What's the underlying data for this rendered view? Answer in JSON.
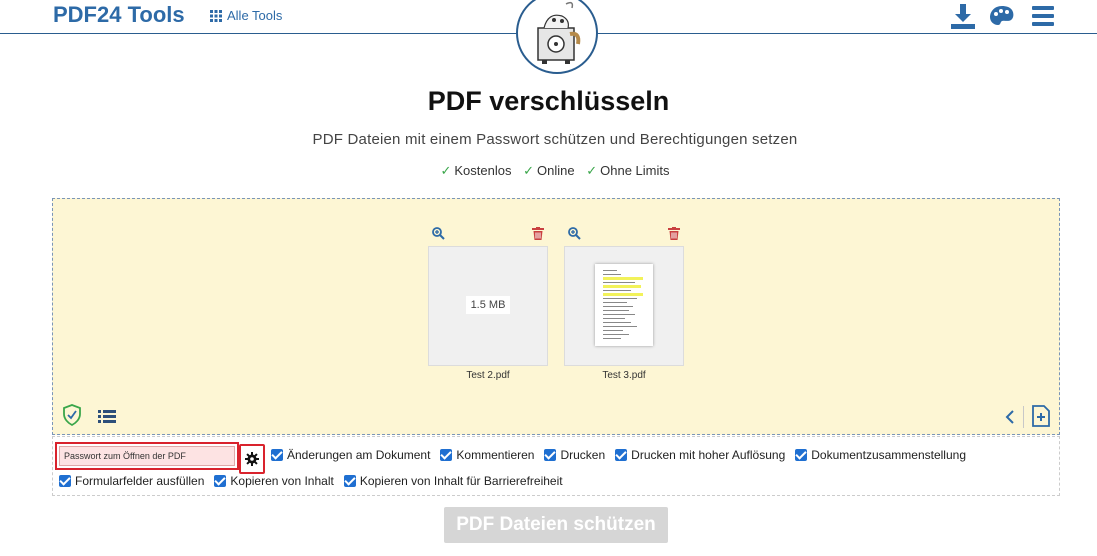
{
  "header": {
    "brand": "PDF24 Tools",
    "all_tools": "Alle Tools"
  },
  "page": {
    "title": "PDF verschlüsseln",
    "subtitle": "PDF Dateien mit einem Passwort schützen und Berechtigungen setzen",
    "features": [
      "Kostenlos",
      "Online",
      "Ohne Limits"
    ]
  },
  "files": [
    {
      "name": "Test 2.pdf",
      "size": "1.5 MB"
    },
    {
      "name": "Test 3.pdf"
    }
  ],
  "options": {
    "password_placeholder": "Passwort zum Öffnen der PDF",
    "checkboxes": [
      {
        "label": "Änderungen am Dokument",
        "checked": true
      },
      {
        "label": "Kommentieren",
        "checked": true
      },
      {
        "label": "Drucken",
        "checked": true
      },
      {
        "label": "Drucken mit hoher Auflösung",
        "checked": true
      },
      {
        "label": "Dokumentzusammenstellung",
        "checked": true
      },
      {
        "label": "Formularfelder ausfüllen",
        "checked": true
      },
      {
        "label": "Kopieren von Inhalt",
        "checked": true
      },
      {
        "label": "Kopieren von Inhalt für Barrierefreiheit",
        "checked": true
      }
    ]
  },
  "submit_label": "PDF Dateien schützen",
  "colors": {
    "brand": "#2d6aa7",
    "dropzone": "#fdf6d4",
    "check": "#3aa64a",
    "delete": "#c94040",
    "highlight": "#d9232d"
  }
}
